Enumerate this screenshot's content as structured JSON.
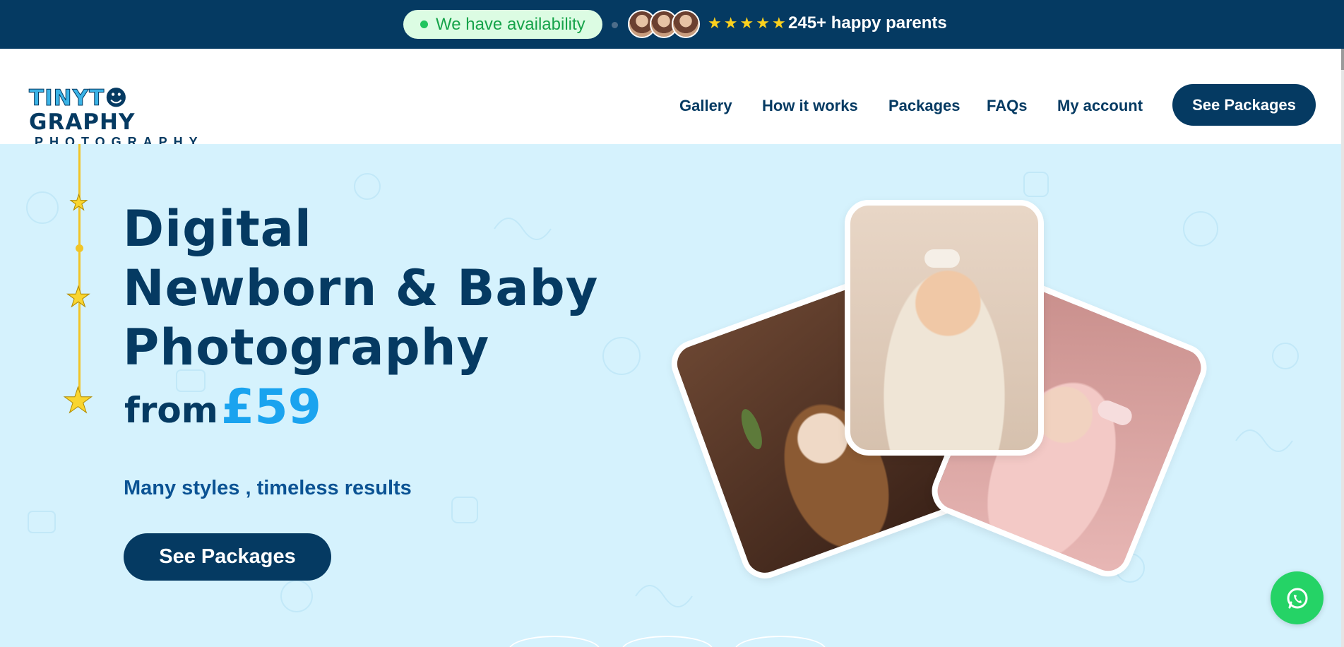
{
  "topbar": {
    "availability": "We have availability",
    "rating_stars": 5,
    "happy_parents": "245+ happy parents",
    "avatars": [
      "parent-avatar",
      "parent-avatar",
      "parent-avatar"
    ],
    "bg_color": "#053a62"
  },
  "header": {
    "logo_line1_a": "TINYT",
    "logo_line1_b": "GRAPHY",
    "logo_line2": "PHOTOGRAPHY",
    "nav": [
      "Gallery",
      "How it works",
      "Packages",
      "FAQs",
      "My account"
    ],
    "cta": "See Packages"
  },
  "hero": {
    "title_line1": "Digital",
    "title_line2": "Newborn & Baby",
    "title_line3": "Photography",
    "from": "from",
    "price": "£59",
    "tagline": "Many styles , timeless results",
    "cta": "See Packages",
    "accent_color": "#1aa3ef",
    "bg_color": "#d5f2fd"
  },
  "whatsapp": {
    "icon": "whatsapp-icon",
    "color": "#25d366"
  }
}
